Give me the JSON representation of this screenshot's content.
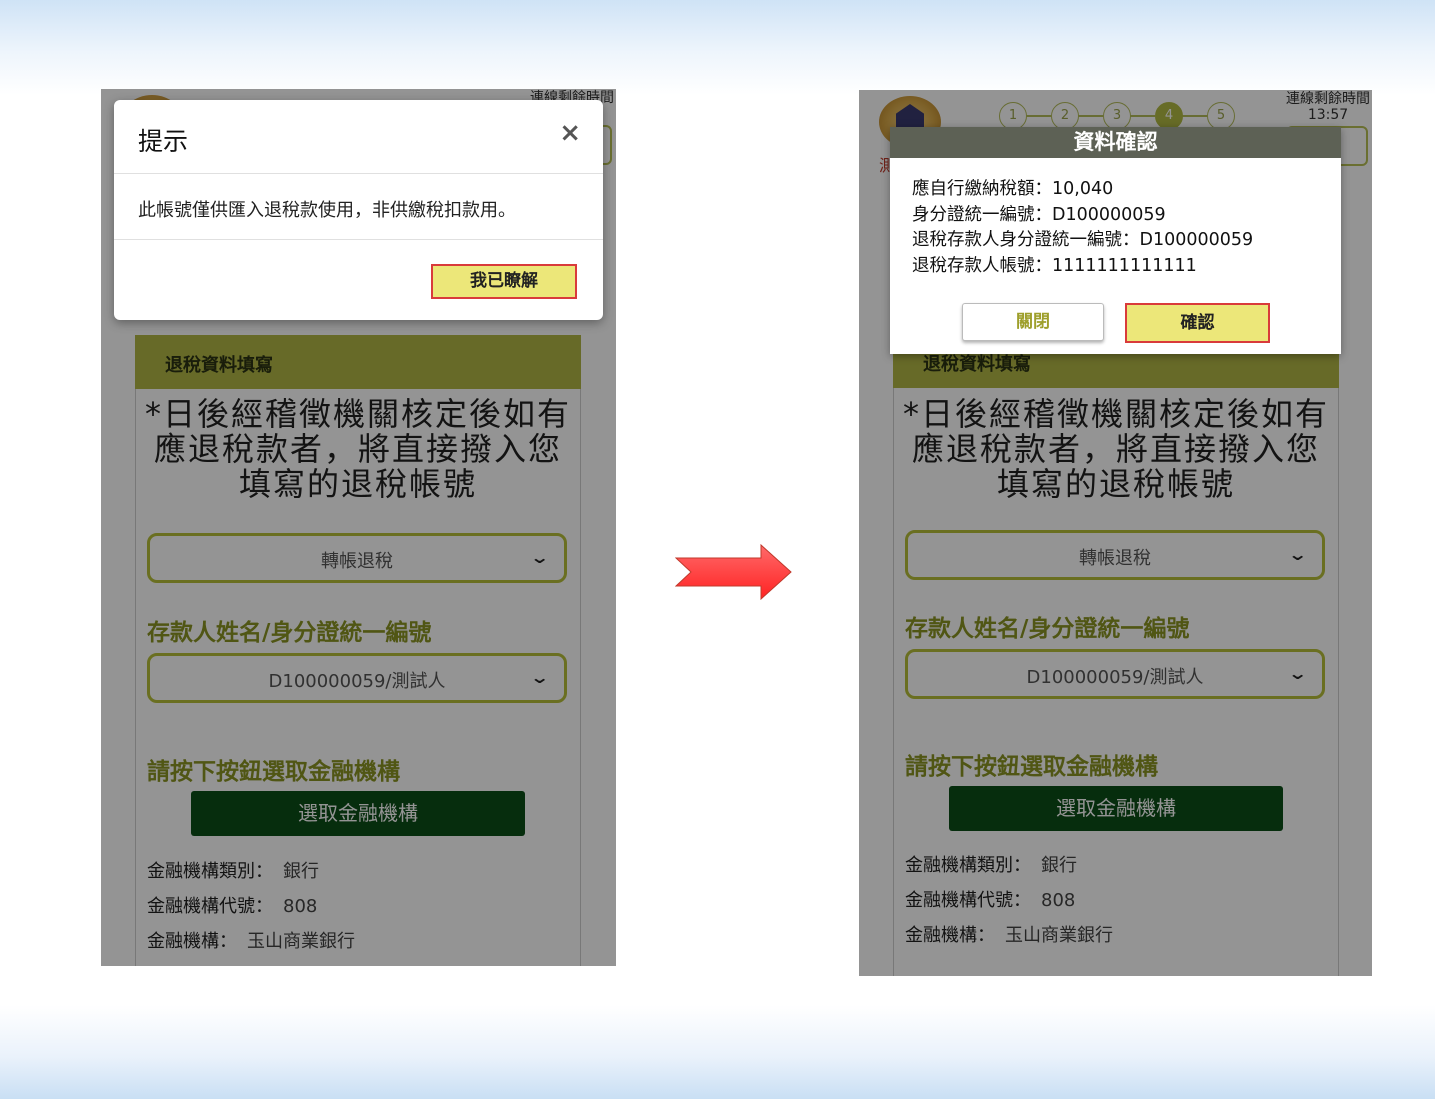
{
  "colors": {
    "section_header": "#b1b745",
    "dropdown_border": "#b7bf39",
    "select_button": "#0c4e17",
    "green_label": "#8b9423",
    "highlight_button": "#ece779",
    "highlight_border": "#d93b3b",
    "arrow": "#ff3b3b"
  },
  "arrow": {
    "icon": "right-arrow-icon"
  },
  "left": {
    "timer_label": "連線剩餘時間",
    "section_title": "退稅資料填寫",
    "notice": "*日後經稽徵機關核定後如有應退稅款者，將直接撥入您填寫的退稅帳號",
    "refund_method": "轉帳退稅",
    "depositor_label": "存款人姓名/身分證統一編號",
    "depositor_value": "D100000059/測試人",
    "bank_prompt": "請按下按鈕選取金融機構",
    "select_bank_button": "選取金融機構",
    "bank_type_label": "金融機構類別：",
    "bank_type_value": "銀行",
    "bank_code_label": "金融機構代號：",
    "bank_code_value": "808",
    "bank_name_label": "金融機構：",
    "bank_name_value": "玉山商業銀行",
    "modal": {
      "title": "提示",
      "close_symbol": "×",
      "message": "此帳號僅供匯入退稅款使用，非供繳稅扣款用。",
      "ack_button": "我已瞭解"
    }
  },
  "right": {
    "logo_fragment": "測",
    "steps": [
      "1",
      "2",
      "3",
      "4",
      "5"
    ],
    "active_step": "4",
    "timer_label": "連線剩餘時間",
    "timer_value": "13:57",
    "section_title": "退稅資料填寫",
    "notice": "*日後經稽徵機關核定後如有應退稅款者，將直接撥入您填寫的退稅帳號",
    "refund_method": "轉帳退稅",
    "depositor_label": "存款人姓名/身分證統一編號",
    "depositor_value": "D100000059/測試人",
    "bank_prompt": "請按下按鈕選取金融機構",
    "select_bank_button": "選取金融機構",
    "bank_type_label": "金融機構類別：",
    "bank_type_value": "銀行",
    "bank_code_label": "金融機構代號：",
    "bank_code_value": "808",
    "bank_name_label": "金融機構：",
    "bank_name_value": "玉山商業銀行",
    "modal": {
      "title": "資料確認",
      "lines": [
        "應自行繳納稅額：10,040",
        "身分證統一編號：D100000059",
        "退稅存款人身分證統一編號：D100000059",
        "退稅存款人帳號：1111111111111"
      ],
      "close_button": "關閉",
      "confirm_button": "確認"
    }
  }
}
